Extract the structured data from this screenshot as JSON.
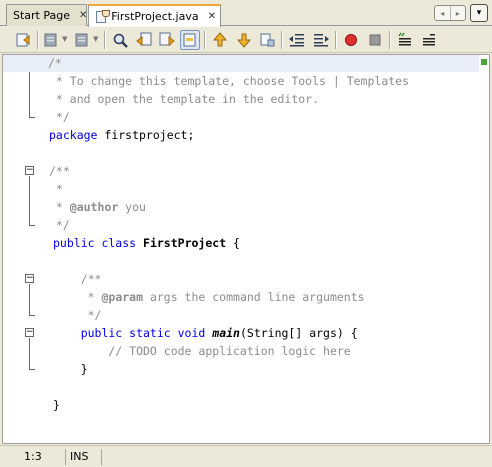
{
  "tabs": [
    {
      "label": "Start Page",
      "active": false
    },
    {
      "label": "FirstProject.java",
      "active": true
    }
  ],
  "tab_icons": {
    "file": "java-file-icon",
    "close": "close-icon"
  },
  "nav": {
    "left": "◂",
    "right": "▸",
    "menu": "▾"
  },
  "toolbar_icons": [
    "back-history-icon",
    "forward-history-icon",
    "last-edit-icon",
    "find-icon",
    "find-previous-icon",
    "find-next-icon",
    "toggle-highlight-icon",
    "previous-bookmark-icon",
    "next-bookmark-icon",
    "toggle-bookmark-icon",
    "shift-left-icon",
    "shift-right-icon",
    "start-macro-icon",
    "stop-macro-icon",
    "comment-icon",
    "uncomment-icon"
  ],
  "code": [
    [
      {
        "t": "/*",
        "c": "cmt"
      }
    ],
    [
      {
        "t": " * To change this template, choose Tools | Templates",
        "c": "cmt"
      }
    ],
    [
      {
        "t": " * and open the template in the editor.",
        "c": "cmt"
      }
    ],
    [
      {
        "t": " */",
        "c": "cmt"
      }
    ],
    [
      {
        "t": "package",
        "c": "kw"
      },
      {
        "t": " firstproject;",
        "c": ""
      }
    ],
    [],
    [
      {
        "t": "/**",
        "c": "cmt"
      }
    ],
    [
      {
        "t": " *",
        "c": "cmt"
      }
    ],
    [
      {
        "t": " * ",
        "c": "cmt"
      },
      {
        "t": "@author",
        "c": "tag"
      },
      {
        "t": " you",
        "c": "cmt"
      }
    ],
    [
      {
        "t": " */",
        "c": "cmt"
      }
    ],
    [
      {
        "t": "public class",
        "c": "kw"
      },
      {
        "t": " ",
        "c": ""
      },
      {
        "t": "FirstProject",
        "c": "bold"
      },
      {
        "t": " {",
        "c": ""
      }
    ],
    [],
    [
      {
        "t": "    /**",
        "c": "cmt"
      }
    ],
    [
      {
        "t": "     * ",
        "c": "cmt"
      },
      {
        "t": "@param",
        "c": "tag"
      },
      {
        "t": " args the command line arguments",
        "c": "cmt"
      }
    ],
    [
      {
        "t": "     */",
        "c": "cmt"
      }
    ],
    [
      {
        "t": "    public static void",
        "c": "kw"
      },
      {
        "t": " ",
        "c": ""
      },
      {
        "t": "main",
        "c": "meth"
      },
      {
        "t": "(String[] args) {",
        "c": ""
      }
    ],
    [
      {
        "t": "        // TODO code application logic here",
        "c": "cmt"
      }
    ],
    [
      {
        "t": "    }",
        "c": ""
      }
    ],
    [],
    [
      {
        "t": "}",
        "c": ""
      }
    ]
  ],
  "fold_markers": {
    "collapse": "−"
  },
  "status": {
    "position": "1:3",
    "mode": "INS"
  }
}
